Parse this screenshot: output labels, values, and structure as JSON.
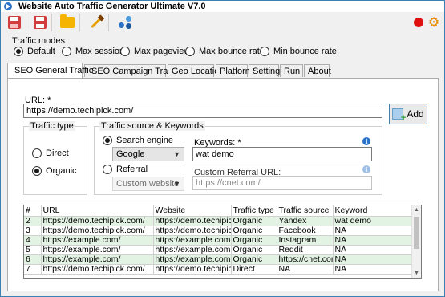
{
  "window": {
    "title": "Website Auto Traffic Generator Ultimate V7.0"
  },
  "traffic_modes": {
    "label": "Traffic modes",
    "options": [
      "Default",
      "Max sessions",
      "Max pageviews",
      "Max bounce rate",
      "Min bounce rate"
    ],
    "selected": "Default"
  },
  "tabs": [
    {
      "label": "SEO General Traffic",
      "active": true
    },
    {
      "label": "SEO Campaign Traffic"
    },
    {
      "label": "Geo Location"
    },
    {
      "label": "Platform"
    },
    {
      "label": "Settings"
    },
    {
      "label": "Run"
    },
    {
      "label": "About"
    }
  ],
  "form": {
    "url_label": "URL: *",
    "url_value": "https://demo.techipick.com/",
    "add_label": "Add",
    "traffic_type": {
      "label": "Traffic type",
      "direct": "Direct",
      "organic": "Organic",
      "selected": "Organic"
    },
    "source": {
      "label": "Traffic source & Keywords",
      "search_engine": "Search engine",
      "search_engine_value": "Google",
      "referral": "Referral",
      "referral_value": "Custom website",
      "keywords_label": "Keywords: *",
      "keywords_value": "wat demo",
      "custom_referral_label": "Custom Referral URL:",
      "custom_referral_placeholder": "https://cnet.com/",
      "info_glyph": "i"
    }
  },
  "table": {
    "headers": [
      "#",
      "URL",
      "Website",
      "Traffic type",
      "Traffic source",
      "Keyword"
    ],
    "rows": [
      [
        "2",
        "https://demo.techipick.com/",
        "https://demo.techipick.cc",
        "Organic",
        "Yandex",
        "wat demo"
      ],
      [
        "3",
        "https://demo.techipick.com/",
        "https://demo.techipick.cc",
        "Organic",
        "Facebook",
        "NA"
      ],
      [
        "4",
        "https://example.com/",
        "https://example.com",
        "Organic",
        "Instagram",
        "NA"
      ],
      [
        "5",
        "https://example.com/",
        "https://example.com",
        "Organic",
        "Reddit",
        "NA"
      ],
      [
        "6",
        "https://example.com/",
        "https://example.com",
        "Organic",
        "https://cnet.com/",
        "NA"
      ],
      [
        "7",
        "https://demo.techipick.com/",
        "https://demo.techipick.cc",
        "Direct",
        "NA",
        "NA"
      ]
    ]
  },
  "colors": {
    "accent": "#2a72c9",
    "row_green": "#e3f3e3",
    "row_blue": "#d9e6f7",
    "record": "#e01010"
  },
  "toolbar_icons": [
    "save-icon",
    "save-as-icon",
    "open-folder-icon",
    "clear-wand-icon",
    "network-icon",
    "record-icon",
    "gear-icon"
  ]
}
